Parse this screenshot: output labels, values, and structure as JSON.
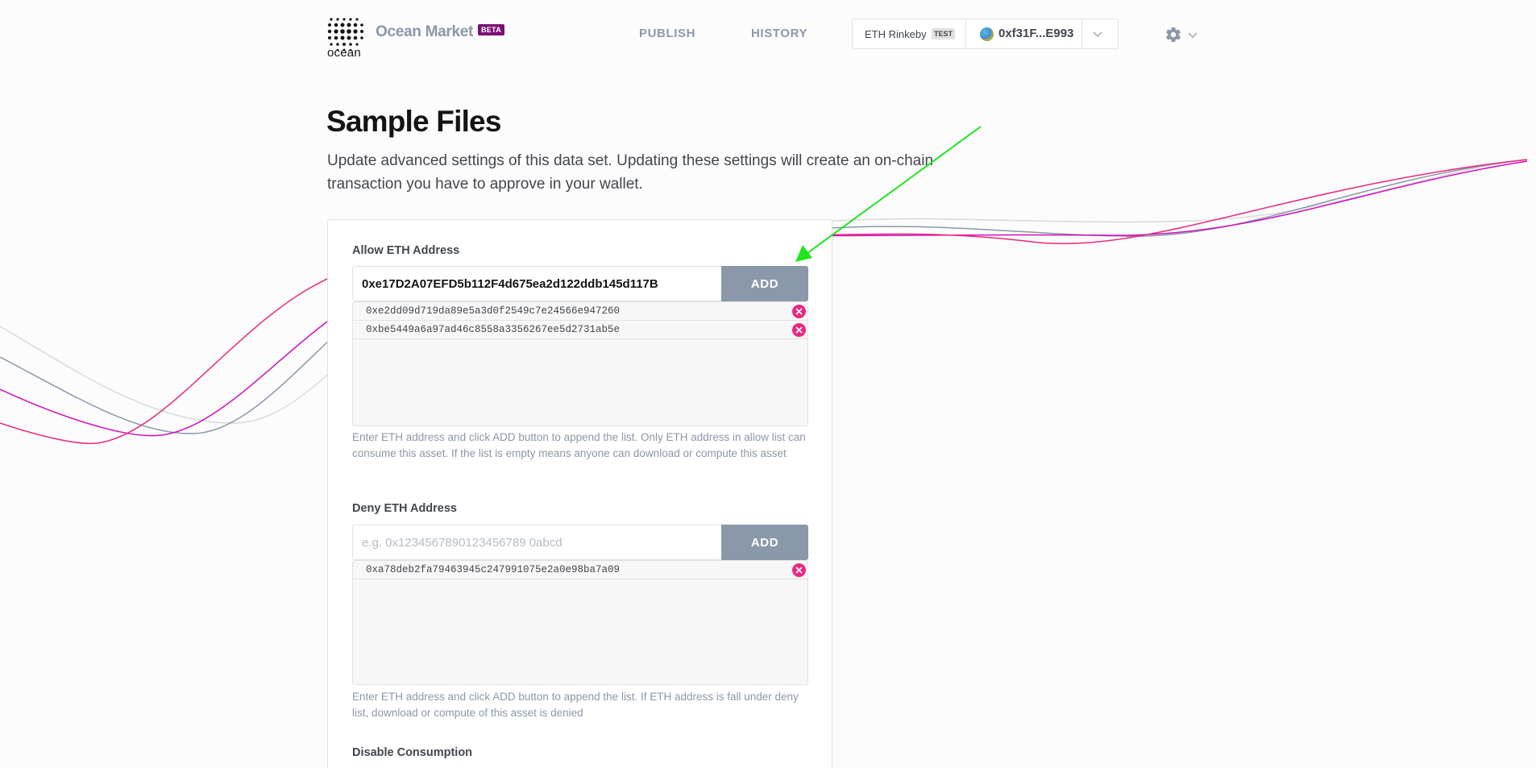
{
  "header": {
    "logo_word": "ocean",
    "brand": "Ocean Market",
    "beta_badge": "BETA",
    "nav": [
      {
        "label": "PUBLISH"
      },
      {
        "label": "HISTORY"
      }
    ],
    "wallet": {
      "network": "ETH Rinkeby",
      "network_badge": "TEST",
      "account": "0xf31F...E993"
    },
    "icons": [
      "ocean-logo-icon",
      "gear-icon",
      "chevron-down-icon"
    ]
  },
  "page": {
    "title": "Sample Files",
    "description": "Update advanced settings of this data set. Updating these settings will create an on-chain transaction you have to approve in your wallet."
  },
  "allow": {
    "label": "Allow ETH Address",
    "input_value": "0xe17D2A07EFD5b112F4d675ea2d122ddb145d117B",
    "add_label": "ADD",
    "items": [
      "0xe2dd09d719da89e5a3d0f2549c7e24566e947260",
      "0xbe5449a6a97ad46c8558a3356267ee5d2731ab5e"
    ],
    "help": "Enter ETH address and click ADD button to append the list. Only ETH address in allow list can consume this asset. If the list is empty means anyone can download or compute this asset"
  },
  "deny": {
    "label": "Deny ETH Address",
    "placeholder": "e.g. 0x1234567890123456789 0abcd",
    "add_label": "ADD",
    "items": [
      "0xa78deb2fa79463945c247991075e2a0e98ba7a09"
    ],
    "help": "Enter ETH address and click ADD button to append the list. If ETH address is fall under deny list, download or compute of this asset is denied"
  },
  "disable": {
    "label": "Disable Consumption"
  },
  "colors": {
    "accent_pink": "#e9297f",
    "brand_purple": "#7b1173",
    "button_grey": "#8b98a9",
    "annotation_arrow": "#1fe51f"
  }
}
